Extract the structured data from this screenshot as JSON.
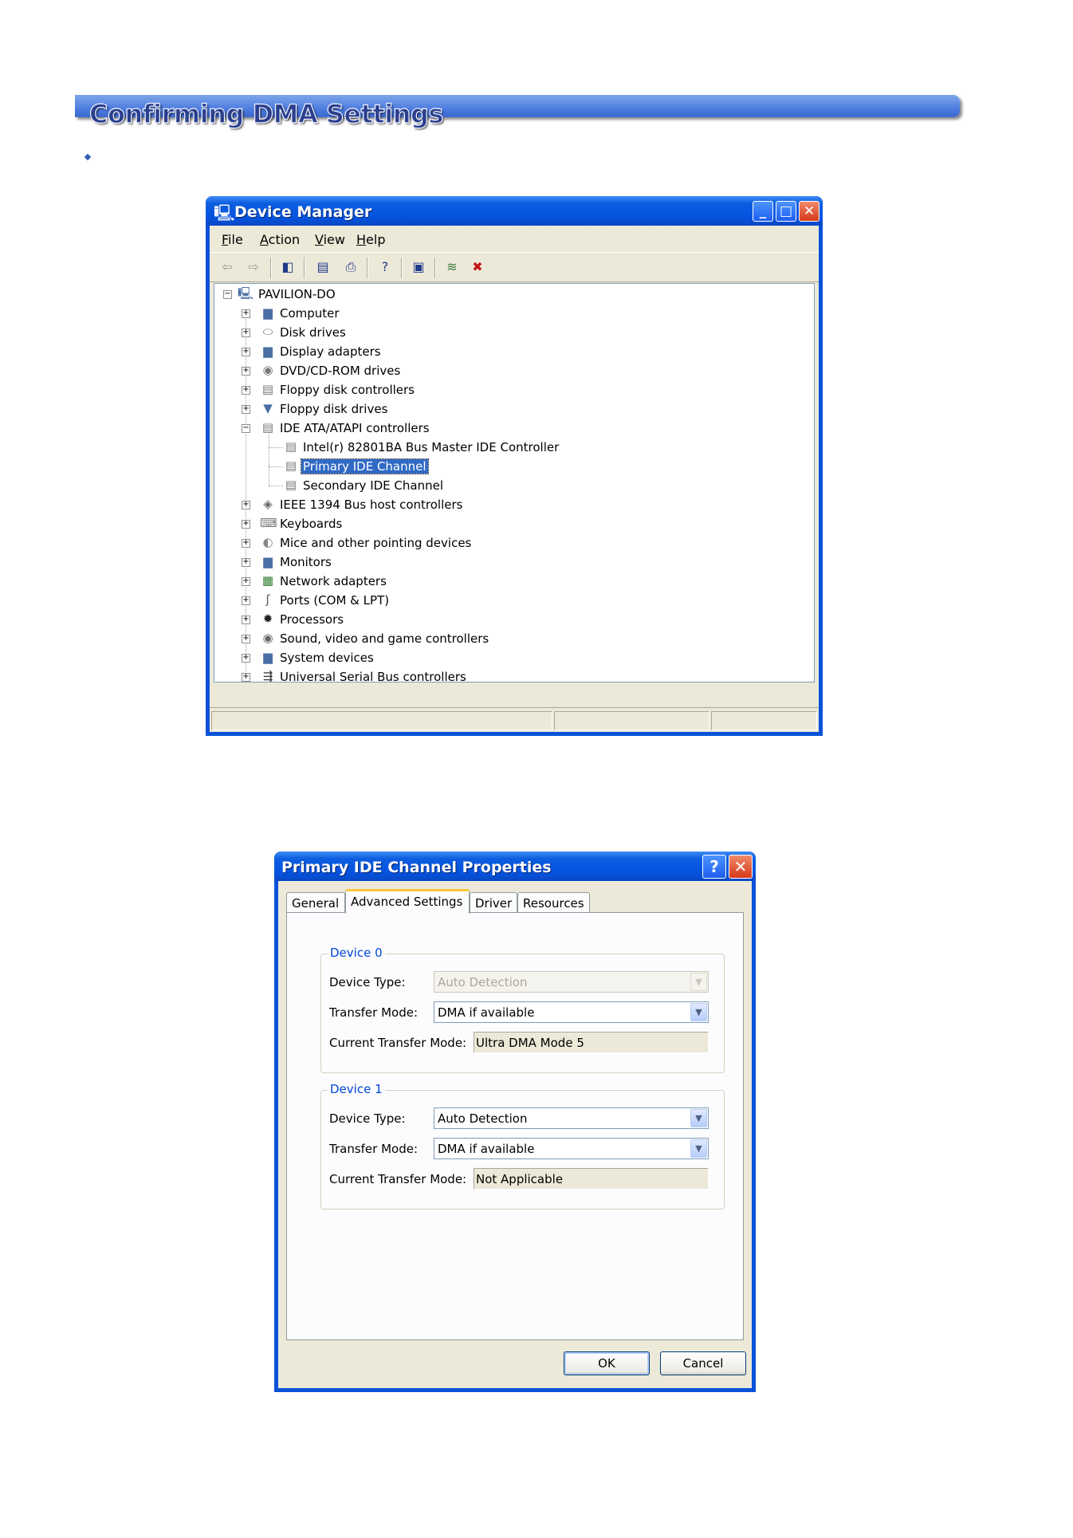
{
  "page": {
    "title": "Confirming DMA Settings"
  },
  "device_manager": {
    "title": "Device Manager",
    "menu": [
      "File",
      "Action",
      "View",
      "Help"
    ],
    "toolbar_icons": [
      "back-arrow-icon",
      "forward-arrow-icon",
      "show-hide-tree-icon",
      "properties-icon",
      "print-icon",
      "help-icon",
      "scan-hardware-icon",
      "update-driver-icon",
      "uninstall-icon"
    ],
    "tree": {
      "root": "PAVILION-DO",
      "items": [
        "Computer",
        "Disk drives",
        "Display adapters",
        "DVD/CD-ROM drives",
        "Floppy disk controllers",
        "Floppy disk drives",
        "IDE ATA/ATAPI controllers",
        "Intel(r) 82801BA Bus Master IDE Controller",
        "Primary IDE Channel",
        "Secondary IDE Channel",
        "IEEE 1394 Bus host controllers",
        "Keyboards",
        "Mice and other pointing devices",
        "Monitors",
        "Network adapters",
        "Ports (COM & LPT)",
        "Processors",
        "Sound, video and game controllers",
        "System devices",
        "Universal Serial Bus controllers"
      ],
      "selected": "Primary IDE Channel"
    }
  },
  "properties": {
    "title": "Primary IDE Channel Properties",
    "tabs": [
      "General",
      "Advanced Settings",
      "Driver",
      "Resources"
    ],
    "active_tab": "Advanced Settings",
    "device0": {
      "title": "Device 0",
      "device_type_label": "Device Type:",
      "device_type_value": "Auto Detection",
      "transfer_mode_label": "Transfer Mode:",
      "transfer_mode_value": "DMA if available",
      "current_mode_label": "Current Transfer Mode:",
      "current_mode_value": "Ultra DMA Mode 5"
    },
    "device1": {
      "title": "Device 1",
      "device_type_label": "Device Type:",
      "device_type_value": "Auto Detection",
      "transfer_mode_label": "Transfer Mode:",
      "transfer_mode_value": "DMA if available",
      "current_mode_label": "Current Transfer Mode:",
      "current_mode_value": "Not Applicable"
    },
    "ok_label": "OK",
    "cancel_label": "Cancel"
  }
}
